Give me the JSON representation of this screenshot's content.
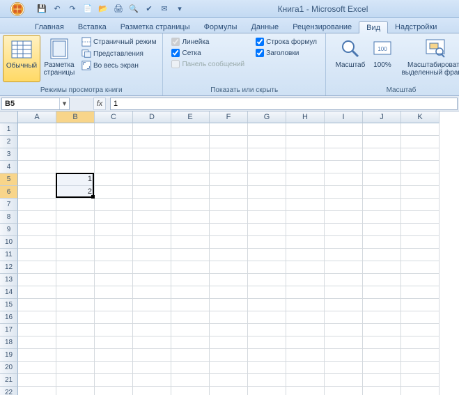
{
  "title": "Книга1 - Microsoft Excel",
  "qat": {
    "save": "💾",
    "undo": "↶",
    "redo": "↷",
    "new": "📄",
    "open": "📂",
    "print": "🖨",
    "preview": "🔍",
    "spell": "✔",
    "email": "✉",
    "more": "▾"
  },
  "tabs": [
    "Главная",
    "Вставка",
    "Разметка страницы",
    "Формулы",
    "Данные",
    "Рецензирование",
    "Вид",
    "Надстройки"
  ],
  "active_tab": 6,
  "ribbon": {
    "group_views": {
      "label": "Режимы просмотра книги",
      "normal": "Обычный",
      "page_layout": "Разметка\nстраницы",
      "page_break": "Страничный режим",
      "custom": "Представления",
      "fullscreen": "Во весь экран"
    },
    "group_show": {
      "label": "Показать или скрыть",
      "ruler": "Линейка",
      "grid": "Сетка",
      "msgpanel": "Панель сообщений",
      "formulabar": "Строка формул",
      "headings": "Заголовки"
    },
    "group_zoom": {
      "label": "Масштаб",
      "zoom": "Масштаб",
      "z100": "100%",
      "zsel": "Масштабировать\nвыделенный фрагме"
    }
  },
  "namebox": "B5",
  "formula": "1",
  "columns": [
    "A",
    "B",
    "C",
    "D",
    "E",
    "F",
    "G",
    "H",
    "I",
    "J",
    "K"
  ],
  "rows": [
    1,
    2,
    3,
    4,
    5,
    6,
    7,
    8,
    9,
    10,
    11,
    12,
    13,
    14,
    15,
    16,
    17,
    18,
    19,
    20,
    21,
    22
  ],
  "cells": {
    "B5": "1",
    "B6": "2"
  },
  "selection": {
    "col": 1,
    "row_start": 4,
    "row_end": 5
  }
}
